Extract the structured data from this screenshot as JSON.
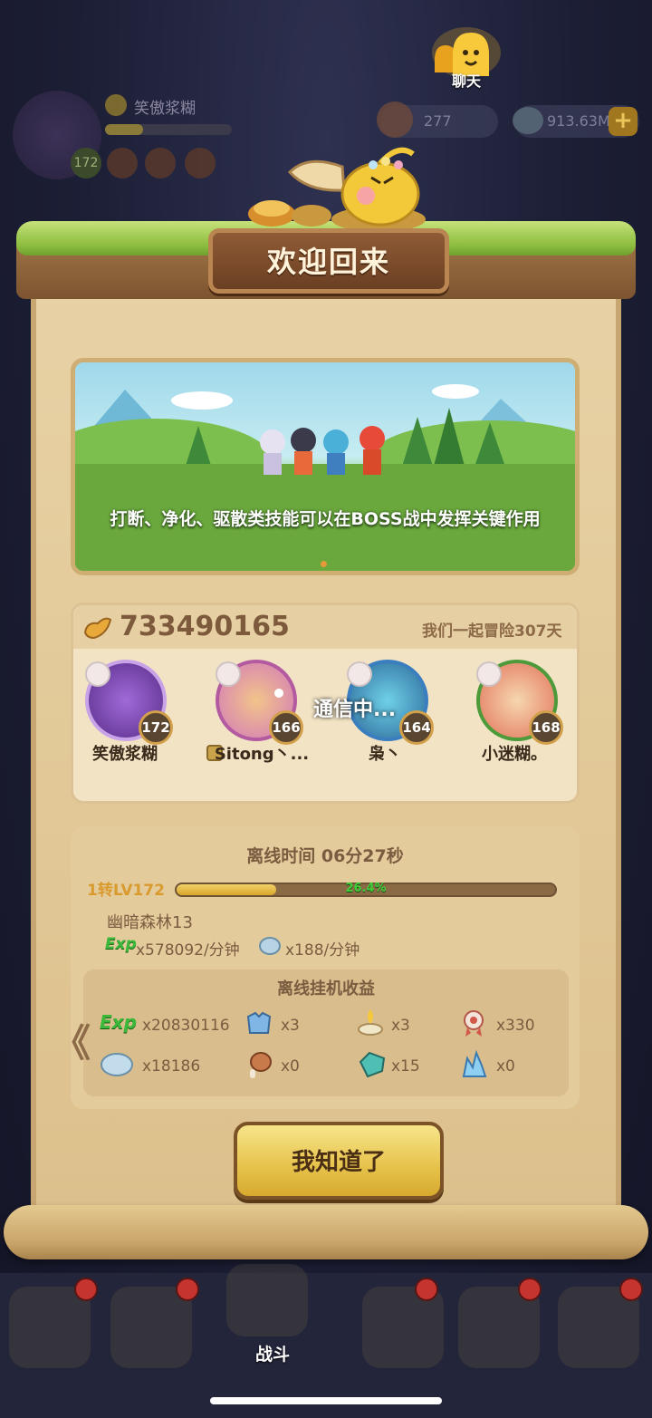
{
  "hud": {
    "chat_label": "聊天",
    "player_name": "笑傲浆糊",
    "player_level": "172",
    "res1": "277",
    "res2": "913.63M",
    "add": "+"
  },
  "dialog": {
    "title": "欢迎回来",
    "tip": "打断、净化、驱散类技能可以在BOSS战中发挥关键作用",
    "power": "733490165",
    "days": "我们一起冒险307天",
    "loading": "通信中...",
    "team": [
      {
        "name": "笑傲浆糊",
        "level": "172"
      },
      {
        "name": "Sitong丶...",
        "level": "166"
      },
      {
        "name": "枭丶",
        "level": "164"
      },
      {
        "name": "小迷糊。",
        "level": "168"
      }
    ],
    "offline_time": "离线时间 06分27秒",
    "lv_label": "1转LV172",
    "progress_text": "26.4%",
    "progress": 0.264,
    "stage": "幽暗森林13",
    "exp_tag": "Exp",
    "exp_rate": "x578092/分钟",
    "crystal_rate": "x188/分钟",
    "rewards_title": "离线挂机收益",
    "rewards": [
      {
        "icon": "exp-icon",
        "value": "x20830116"
      },
      {
        "icon": "armor-icon",
        "value": "x3"
      },
      {
        "icon": "lamp-icon",
        "value": "x3"
      },
      {
        "icon": "medal-icon",
        "value": "x330"
      },
      {
        "icon": "crystal-icon",
        "value": "x18186"
      },
      {
        "icon": "meat-icon",
        "value": "x0"
      },
      {
        "icon": "gem-icon",
        "value": "x15"
      },
      {
        "icon": "ice-crystal-icon",
        "value": "x0"
      }
    ],
    "chevron": "《",
    "ok_label": "我知道了"
  },
  "nav": {
    "battle": "战斗"
  }
}
